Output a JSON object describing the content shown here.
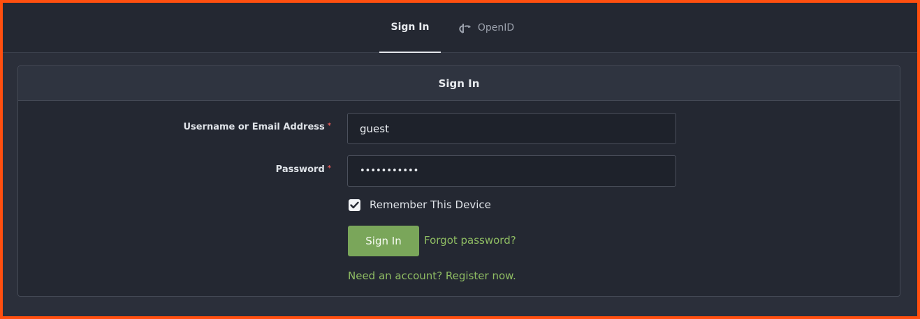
{
  "tabs": {
    "signin": "Sign In",
    "openid": "OpenID"
  },
  "panel": {
    "title": "Sign In"
  },
  "form": {
    "username_label": "Username or Email Address",
    "username_value": "guest",
    "password_label": "Password",
    "password_value": "•••••••••••",
    "required_marker": "*",
    "remember_label": "Remember This Device",
    "remember_checked": true,
    "submit_label": "Sign In",
    "forgot_link": "Forgot password?",
    "register_link": "Need an account? Register now."
  },
  "colors": {
    "accent_orange": "#ff4f0f",
    "primary_green": "#7aa65a",
    "link_green": "#8fbd63",
    "required_red": "#e05858"
  },
  "icons": {
    "openid": "openid-icon",
    "checkmark": "checkmark-icon"
  }
}
